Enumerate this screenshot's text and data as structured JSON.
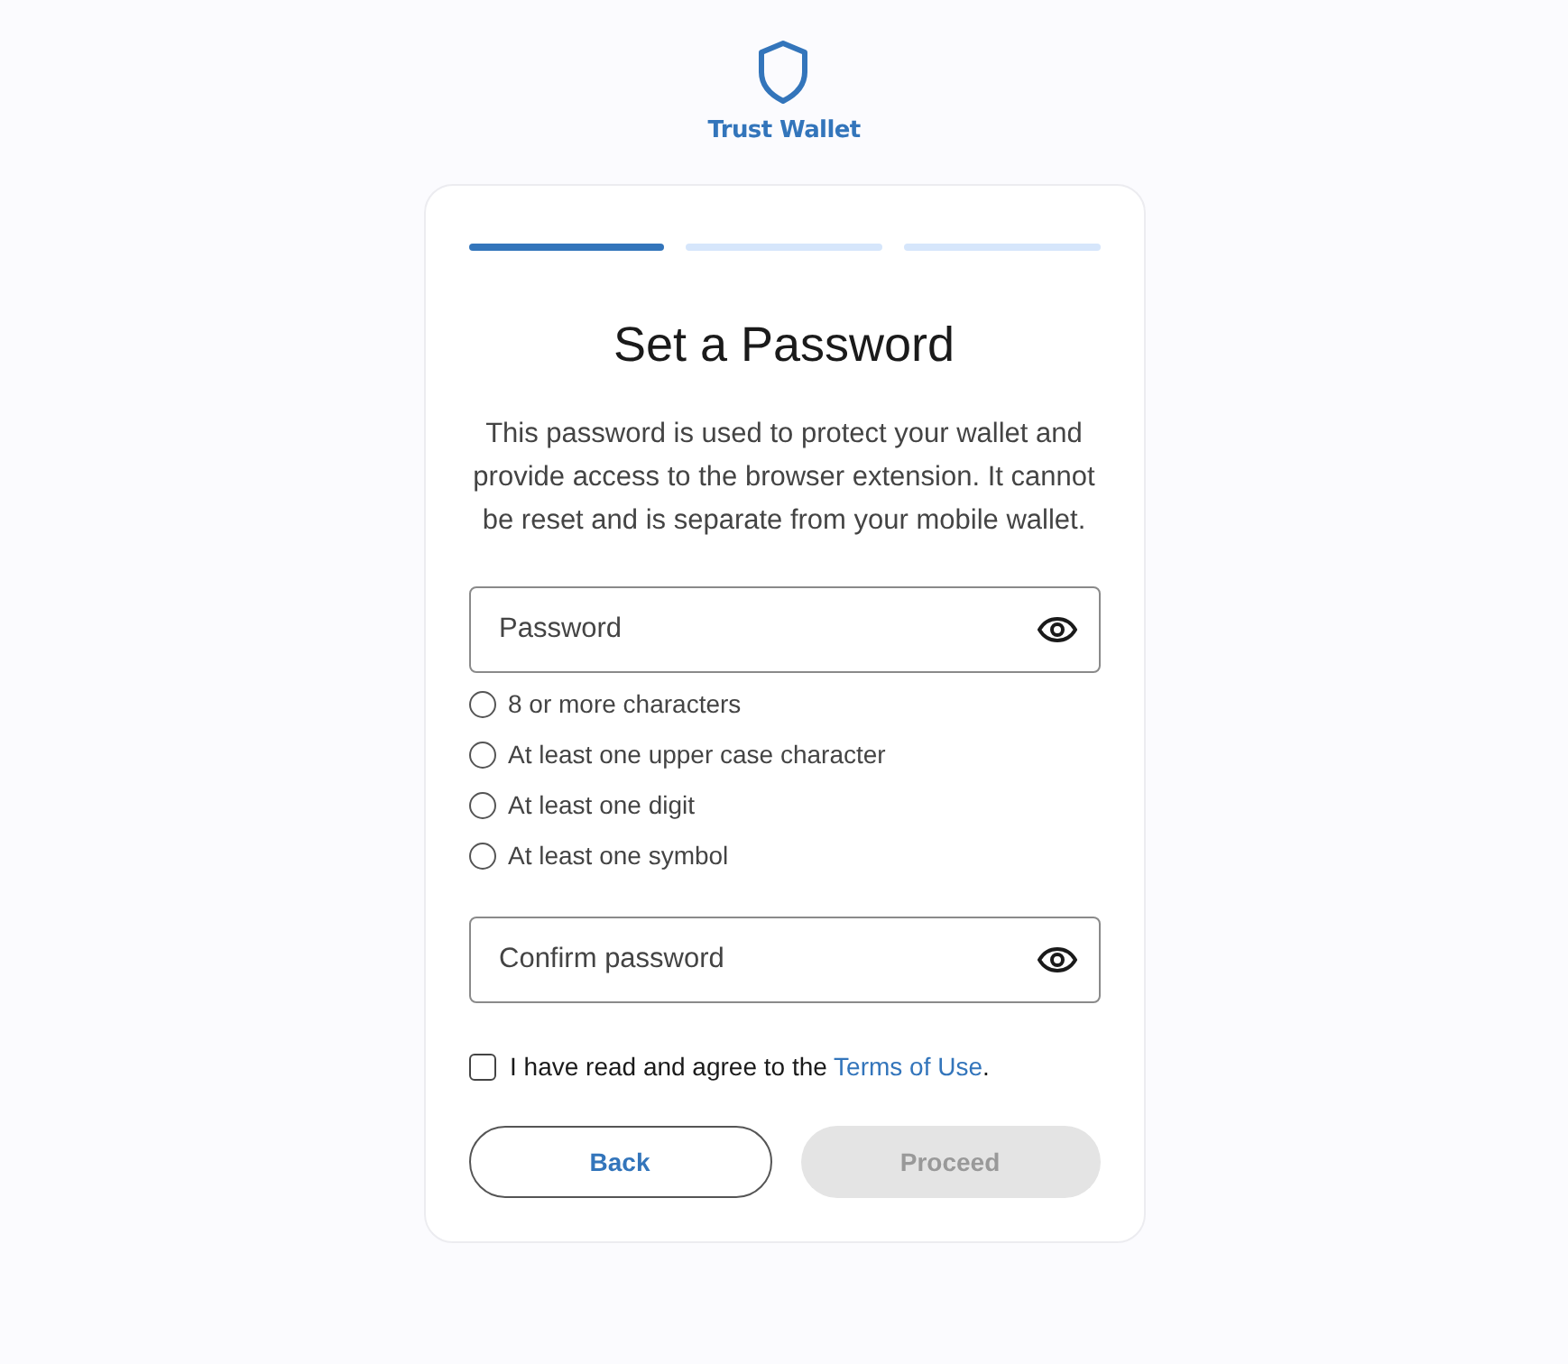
{
  "brand": {
    "name": "Trust Wallet"
  },
  "progress": [
    {
      "selected": true
    },
    {
      "selected": false
    },
    {
      "selected": false
    }
  ],
  "title": "Set a Password",
  "description": "This password is used to protect your wallet and provide access to the browser extension. It cannot be reset and is separate from your mobile wallet.",
  "password_field": {
    "placeholder": "Password"
  },
  "requirements": [
    {
      "label": "8 or more characters",
      "met": false
    },
    {
      "label": "At least one upper case character",
      "met": false
    },
    {
      "label": "At least one digit",
      "met": false
    },
    {
      "label": "At least one symbol",
      "met": false
    }
  ],
  "confirm_field": {
    "placeholder": "Confirm password"
  },
  "agreement": {
    "checked": false,
    "text": "I have read and agree to the ",
    "link": "Terms of Use",
    "after": "."
  },
  "buttons": [
    {
      "label": "Back",
      "kind": "secondary",
      "disabled": false
    },
    {
      "label": "Proceed",
      "kind": "primary",
      "disabled": true
    }
  ]
}
